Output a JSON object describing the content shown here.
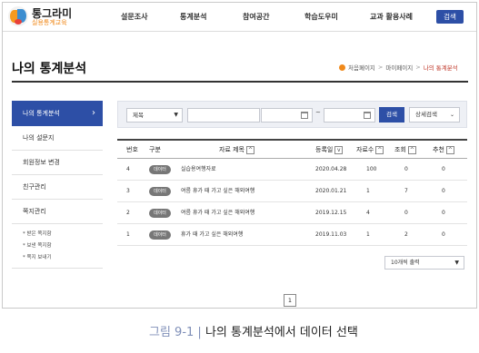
{
  "header": {
    "logo_title": "통그라미",
    "logo_subtitle": "실용통계교육",
    "nav": [
      "설문조사",
      "통계분석",
      "참여공간",
      "학습도우미",
      "교과 활용사례"
    ],
    "search_button": "검색",
    "accent_color": "#2d4fa6"
  },
  "page": {
    "title": "나의 통계분석",
    "breadcrumb": [
      "처음페이지",
      "마이페이지",
      "나의 통계분석"
    ]
  },
  "sidebar": {
    "active": "나의 통계분석",
    "items": [
      "나의 설문지",
      "회원정보 변경",
      "친구관리",
      "쪽지관리"
    ],
    "sub_items": [
      "* 받은 쪽지함",
      "* 보낸 쪽지함",
      "* 쪽지 보내기"
    ]
  },
  "search": {
    "select_value": "제목",
    "text_value": "",
    "date_from": "",
    "date_to": "",
    "tilde": "~",
    "search_label": "검색",
    "advanced_label": "상세검색"
  },
  "table": {
    "headers": [
      "번호",
      "구분",
      "자료 제목",
      "등록일",
      "자료수",
      "조회",
      "추천"
    ],
    "rows": [
      {
        "no": "4",
        "category": "데이터",
        "title": "실습용여행자료",
        "date": "2020.04.28",
        "count": "100",
        "views": "0",
        "recommend": "0"
      },
      {
        "no": "3",
        "category": "데이터",
        "title": "여름 휴가 때 가고 싶은 해외여행",
        "date": "2020.01.21",
        "count": "1",
        "views": "7",
        "recommend": "0"
      },
      {
        "no": "2",
        "category": "데이터",
        "title": "여름 휴가 때 가고 싶은 해외여행",
        "date": "2019.12.15",
        "count": "4",
        "views": "0",
        "recommend": "0"
      },
      {
        "no": "1",
        "category": "데이터",
        "title": "휴가 때 가고 싶은 해외여행",
        "date": "2019.11.03",
        "count": "1",
        "views": "2",
        "recommend": "0"
      }
    ],
    "per_page": "10개씩 출력"
  },
  "pagination": {
    "current": "1"
  },
  "caption": {
    "number": "그림 9-1 |",
    "text": " 나의 통계분석에서 데이터 선택"
  }
}
